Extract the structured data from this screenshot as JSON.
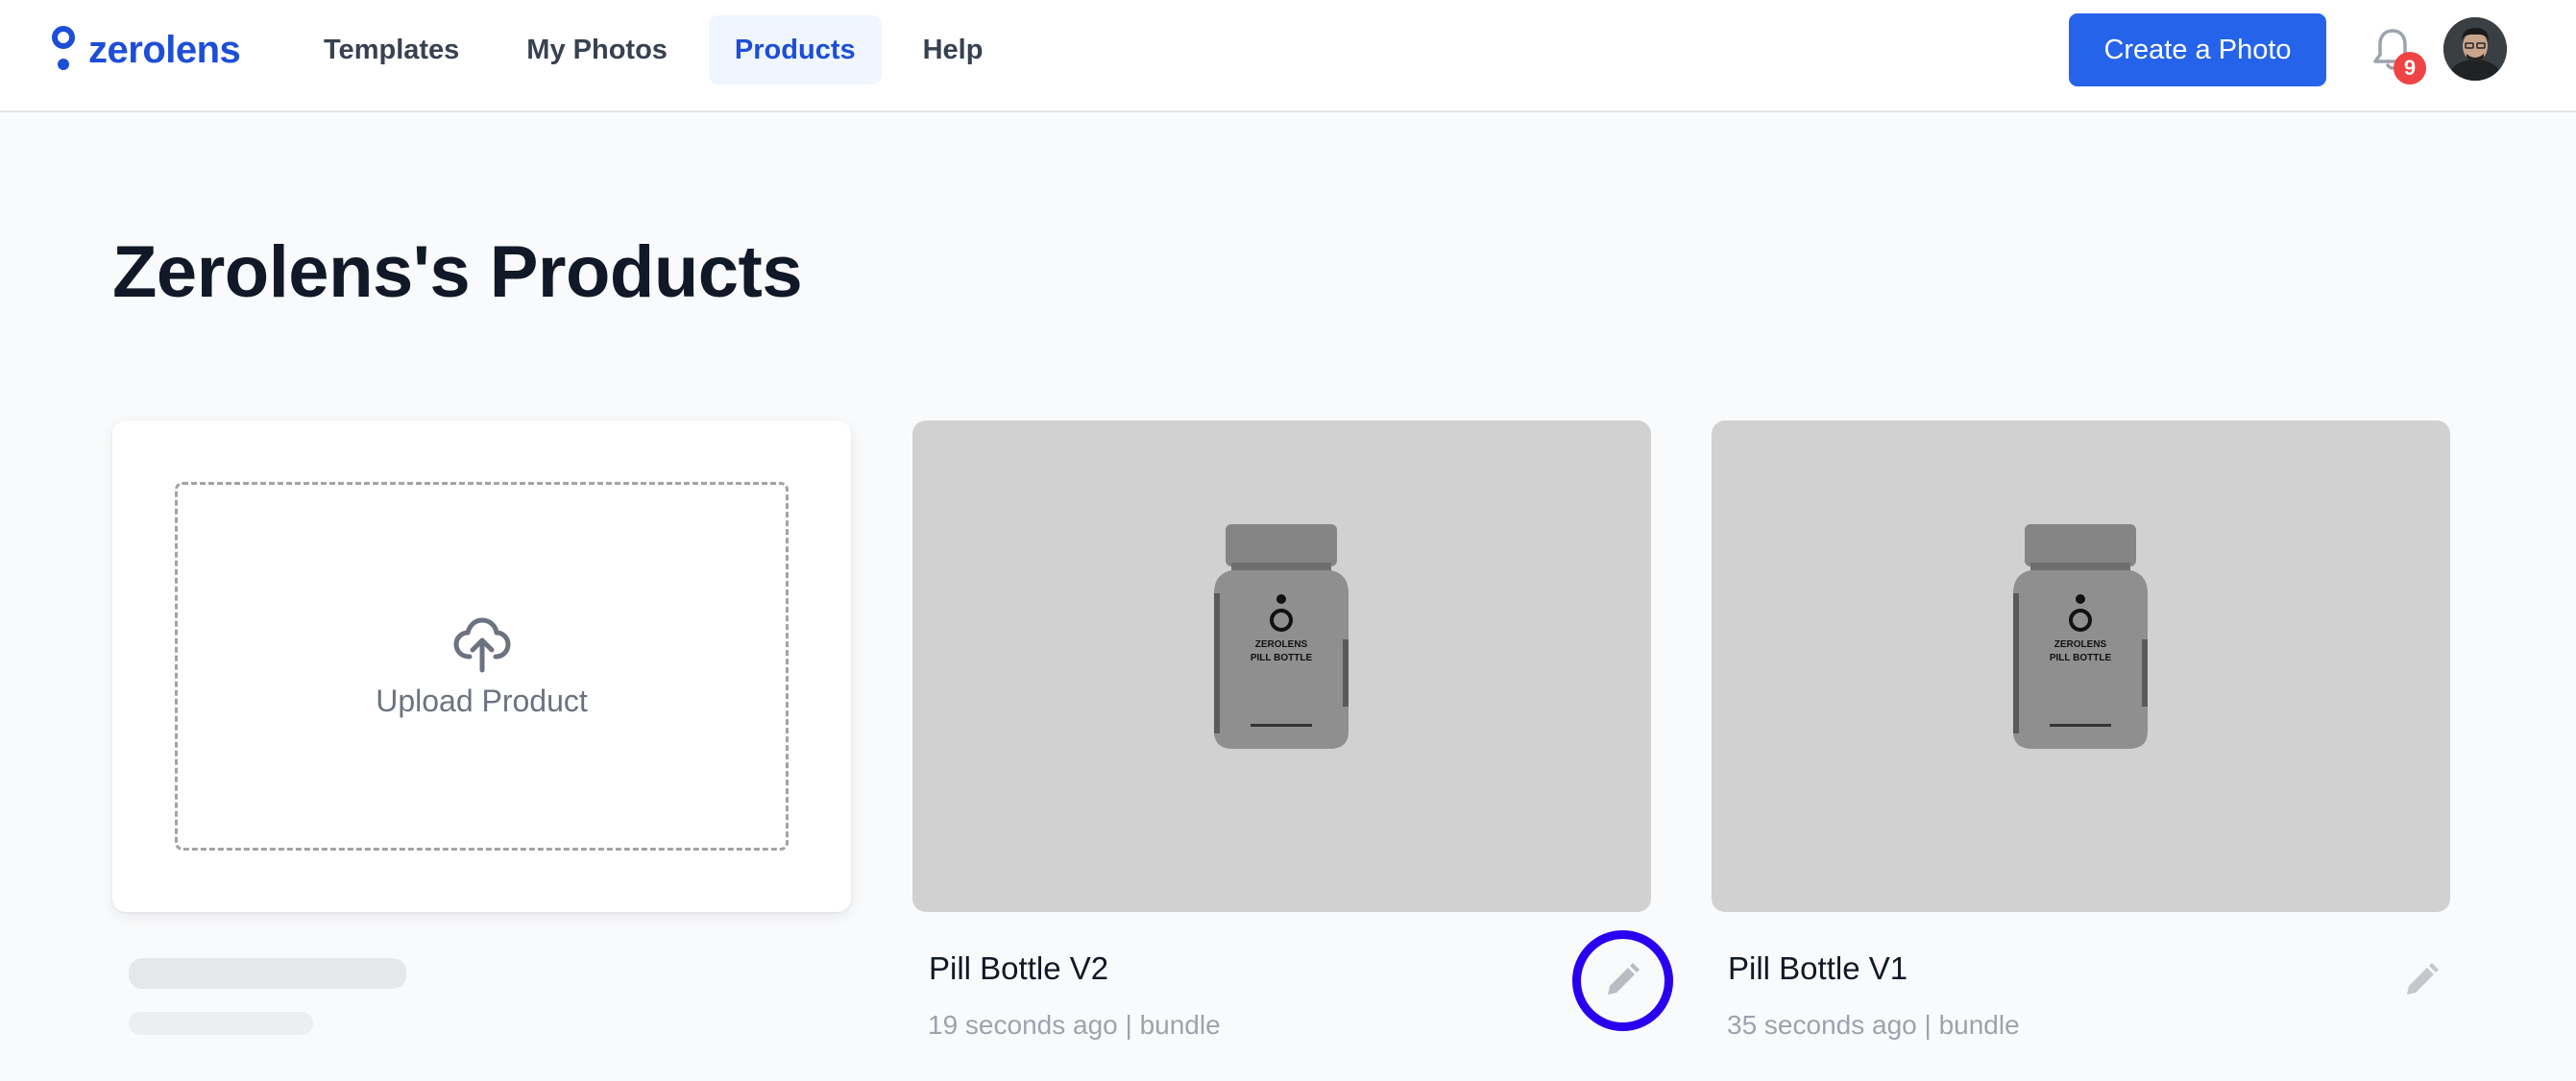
{
  "app": {
    "name": "zerolens",
    "brand_color": "#1d4ed8"
  },
  "nav": {
    "items": [
      {
        "label": "Templates",
        "active": false
      },
      {
        "label": "My Photos",
        "active": false
      },
      {
        "label": "Products",
        "active": true
      },
      {
        "label": "Help",
        "active": false
      }
    ]
  },
  "header": {
    "create_label": "Create a Photo",
    "notification_count": "9"
  },
  "page": {
    "title": "Zerolens's Products"
  },
  "upload": {
    "label": "Upload Product"
  },
  "products": [
    {
      "name": "Pill Bottle V2",
      "time": "19 seconds ago",
      "type": "bundle",
      "bottle_text": "ZEROLENS",
      "bottle_text2": "PILL BOTTLE"
    },
    {
      "name": "Pill Bottle V1",
      "time": "35 seconds ago",
      "type": "bundle",
      "bottle_text": "ZEROLENS",
      "bottle_text2": "PILL BOTTLE"
    }
  ],
  "meta_separator": "|",
  "icons": {
    "logo": "zerolens-logo-icon",
    "bell": "bell-icon",
    "upload": "cloud-upload-icon",
    "edit": "pencil-icon"
  },
  "colors": {
    "primary_button": "#2563eb",
    "badge": "#ef4444",
    "highlight_ring": "#2a00f0"
  }
}
